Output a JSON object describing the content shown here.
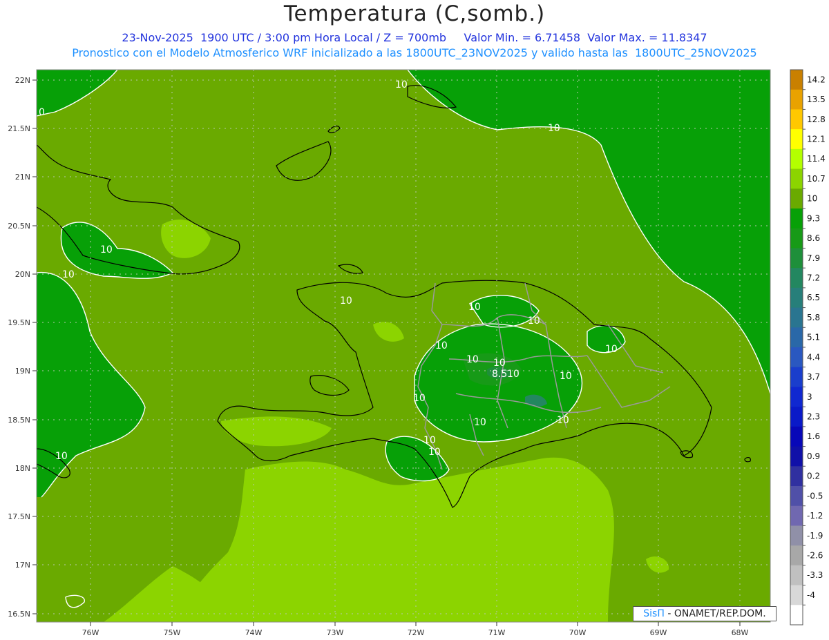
{
  "header": {
    "title": "Temperatura (C,somb.)",
    "line1": "23-Nov-2025  1900 UTC / 3:00 pm Hora Local / Z = 700mb     Valor Min. = 6.71458  Valor Max. = 11.8347",
    "line2": "Pronostico con el Modelo Atmosferico WRF inicializado a las 1800UTC_23NOV2025 y valido hasta las  1800UTC_25NOV2025"
  },
  "axes": {
    "lat_labels": [
      "22N",
      "21.5N",
      "21N",
      "20.5N",
      "20N",
      "19.5N",
      "19N",
      "18.5N",
      "18N",
      "17.5N",
      "17N",
      "16.5N"
    ],
    "lon_labels": [
      "76W",
      "75W",
      "74W",
      "73W",
      "72W",
      "71W",
      "70W",
      "69W",
      "68W"
    ]
  },
  "colorbar": {
    "labels": [
      "14.2",
      "13.5",
      "12.8",
      "12.1",
      "11.4",
      "10.7",
      "10",
      "9.3",
      "8.6",
      "7.9",
      "7.2",
      "6.5",
      "5.8",
      "5.1",
      "4.4",
      "3.7",
      "3",
      "2.3",
      "1.6",
      "0.9",
      "0.2",
      "-0.5",
      "-1.2",
      "-1.9",
      "-2.6",
      "-3.3",
      "-4"
    ],
    "colors": [
      "#c98000",
      "#e9a200",
      "#ffc800",
      "#ffff00",
      "#b4ff00",
      "#8cd400",
      "#6aaa00",
      "#07a007",
      "#179a17",
      "#1e8f3a",
      "#238760",
      "#277f7a",
      "#2a7590",
      "#2a68a8",
      "#2a58c0",
      "#1a3ecc",
      "#1028d0",
      "#0a1ac8",
      "#0808b8",
      "#1010a8",
      "#3030a0",
      "#5050a8",
      "#7068b0",
      "#9090a8",
      "#a8a8a8",
      "#c0c0c0",
      "#d8d8d8",
      "#ffffff"
    ]
  },
  "contour_labels": [
    "10",
    "10",
    "10",
    "10",
    "10",
    "10",
    "10",
    "10",
    "10",
    "10",
    "10",
    "10",
    "10",
    "10",
    "10",
    "10",
    "10",
    "8.5",
    "10",
    "10",
    "0"
  ],
  "credit": {
    "brand": "SisΠ",
    "text": " - ONAMET/REP.DOM."
  }
}
